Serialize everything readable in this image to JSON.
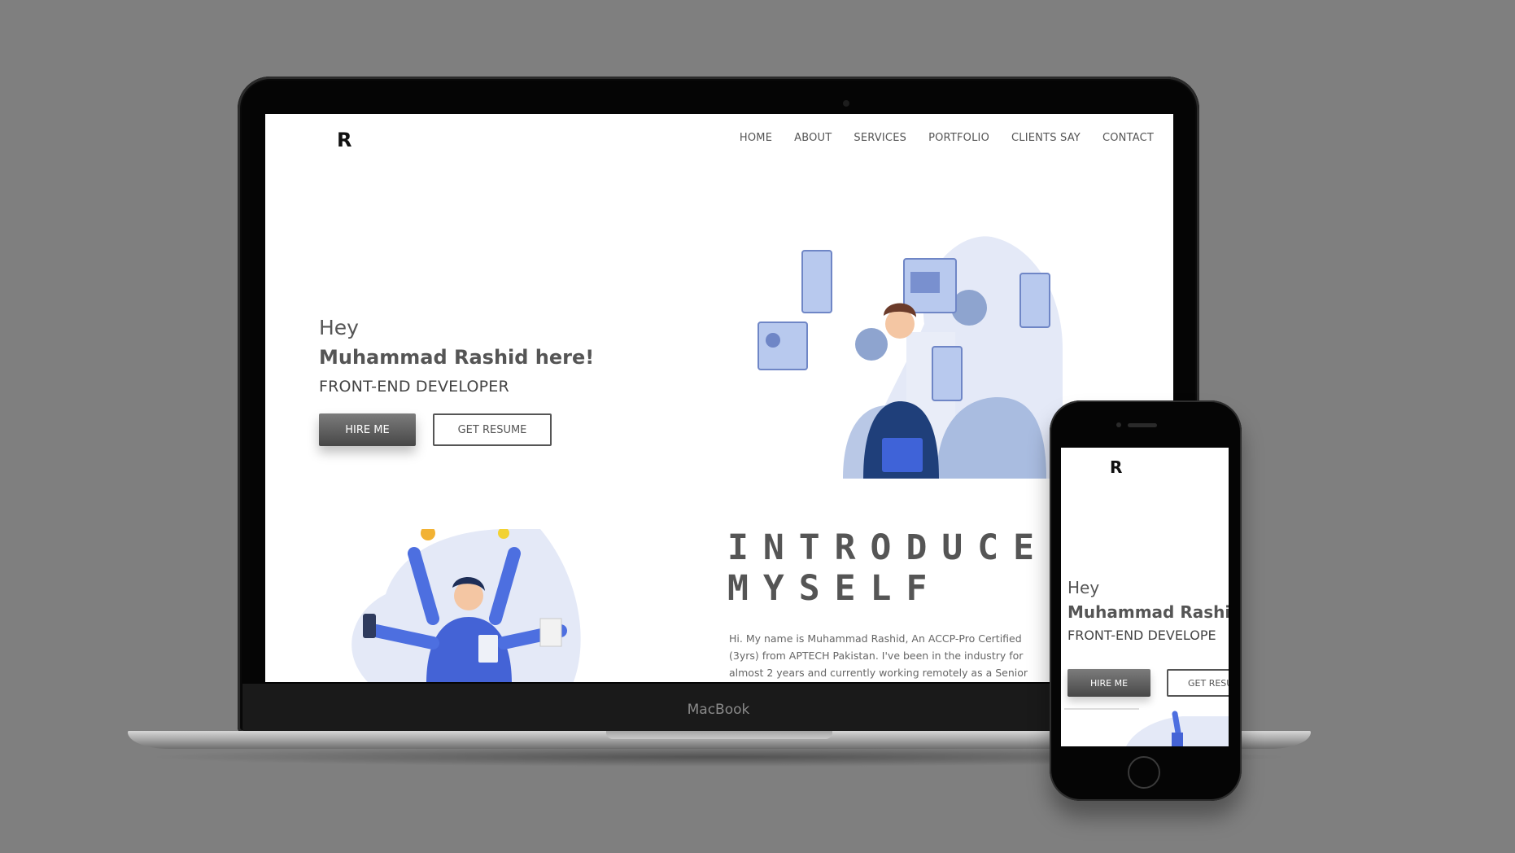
{
  "laptop": {
    "brand": "MacBook"
  },
  "site": {
    "logo": "R",
    "nav": [
      "HOME",
      "ABOUT",
      "SERVICES",
      "PORTFOLIO",
      "CLIENTS SAY",
      "CONTACT"
    ],
    "hero": {
      "greeting": "Hey",
      "name": "Muhammad Rashid here!",
      "role": "FRONT-END DEVELOPER",
      "hire_button": "HIRE ME",
      "resume_button": "GET RESUME"
    },
    "intro": {
      "title_line1": "INTRODUCE",
      "title_line2": "MYSELF",
      "body": "Hi. My name is Muhammad Rashid, An ACCP-Pro Certified (3yrs) from APTECH Pakistan. I've been in the industry for almost 2 years and currently working remotely as a Senior"
    }
  },
  "phone": {
    "logo": "R",
    "greeting": "Hey",
    "name": "Muhammad Rashid",
    "role": "FRONT-END DEVELOPE",
    "hire_button": "HIRE ME",
    "resume_button": "GET RESU"
  },
  "colors": {
    "background": "#7f7f7f",
    "accent_blue": "#3f63d8",
    "light_blue": "#dfe6f6",
    "text_dark": "#555555"
  }
}
